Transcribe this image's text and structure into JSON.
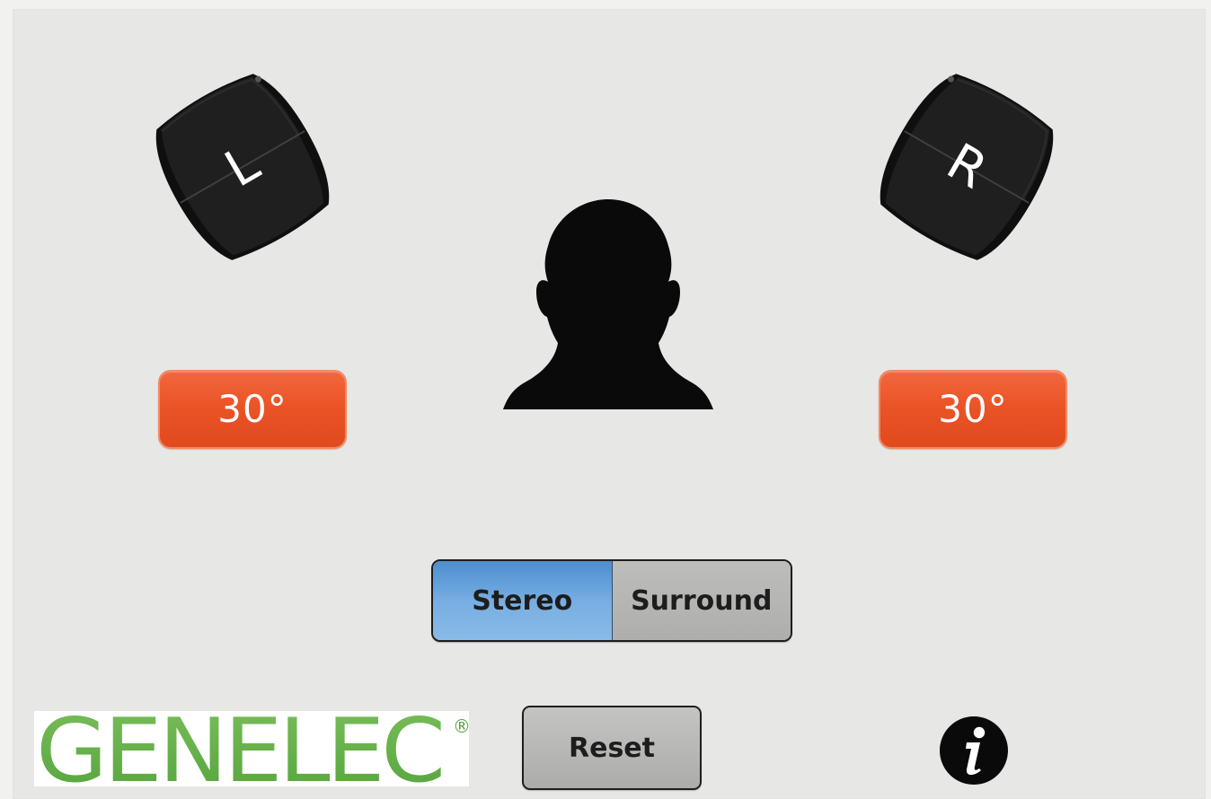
{
  "speakers": {
    "left": {
      "label": "L",
      "angle_display": "30°",
      "angle_value": 30,
      "color": "#ea5326"
    },
    "right": {
      "label": "R",
      "angle_display": "30°",
      "angle_value": 30,
      "color": "#ea5326"
    }
  },
  "mode_switch": {
    "options": [
      {
        "label": "Stereo",
        "selected": true
      },
      {
        "label": "Surround",
        "selected": false
      }
    ]
  },
  "footer": {
    "logo_text": "GENELEC",
    "logo_registered": "®",
    "reset_label": "Reset",
    "info_icon": "info-icon"
  },
  "theme": {
    "background": "#e7e7e5",
    "accent_orange": "#ea5326",
    "selected_blue": "#78aee2",
    "button_gray": "#b5b5b3",
    "logo_green": "#6ab04c"
  }
}
